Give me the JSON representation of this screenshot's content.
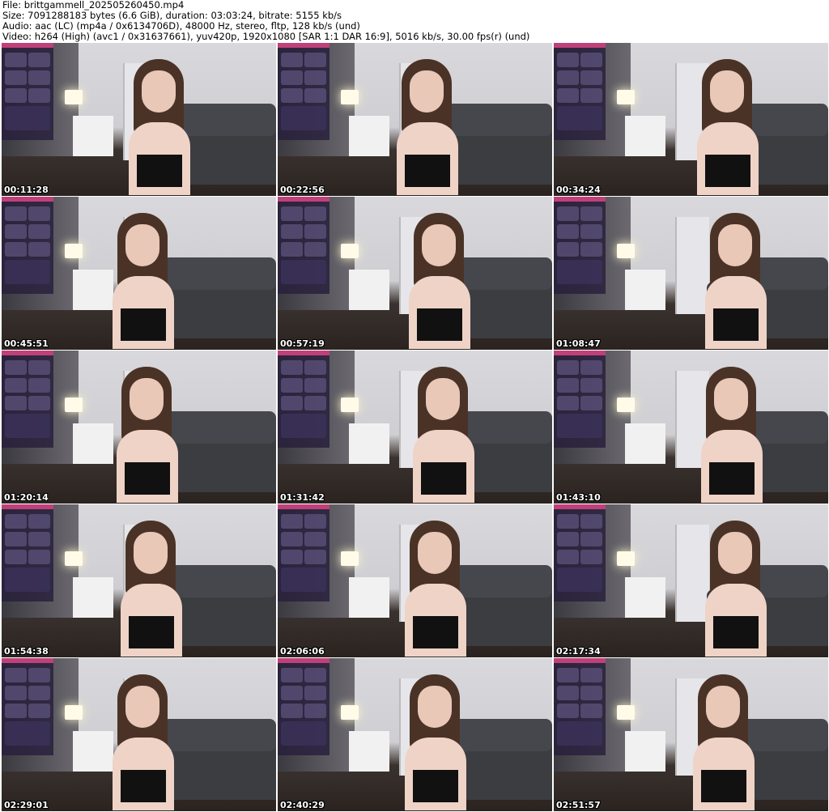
{
  "header": {
    "file": "File: brittgammell_202505260450.mp4",
    "size": "Size: 7091288183 bytes (6.6 GiB), duration: 03:03:24, bitrate: 5155 kb/s",
    "audio": "Audio: aac (LC) (mp4a / 0x6134706D), 48000 Hz, stereo, fltp, 128 kb/s (und)",
    "video": "Video: h264 (High) (avc1 / 0x31637661), yuv420p, 1920x1080 [SAR 1:1 DAR 16:9], 5016 kb/s, 30.00 fps(r) (und)"
  },
  "thumbnails": [
    {
      "timestamp": "00:11:28"
    },
    {
      "timestamp": "00:22:56"
    },
    {
      "timestamp": "00:34:24"
    },
    {
      "timestamp": "00:45:51"
    },
    {
      "timestamp": "00:57:19"
    },
    {
      "timestamp": "01:08:47"
    },
    {
      "timestamp": "01:20:14"
    },
    {
      "timestamp": "01:31:42"
    },
    {
      "timestamp": "01:43:10"
    },
    {
      "timestamp": "01:54:38"
    },
    {
      "timestamp": "02:06:06"
    },
    {
      "timestamp": "02:17:34"
    },
    {
      "timestamp": "02:29:01"
    },
    {
      "timestamp": "02:40:29"
    },
    {
      "timestamp": "02:51:57"
    }
  ]
}
